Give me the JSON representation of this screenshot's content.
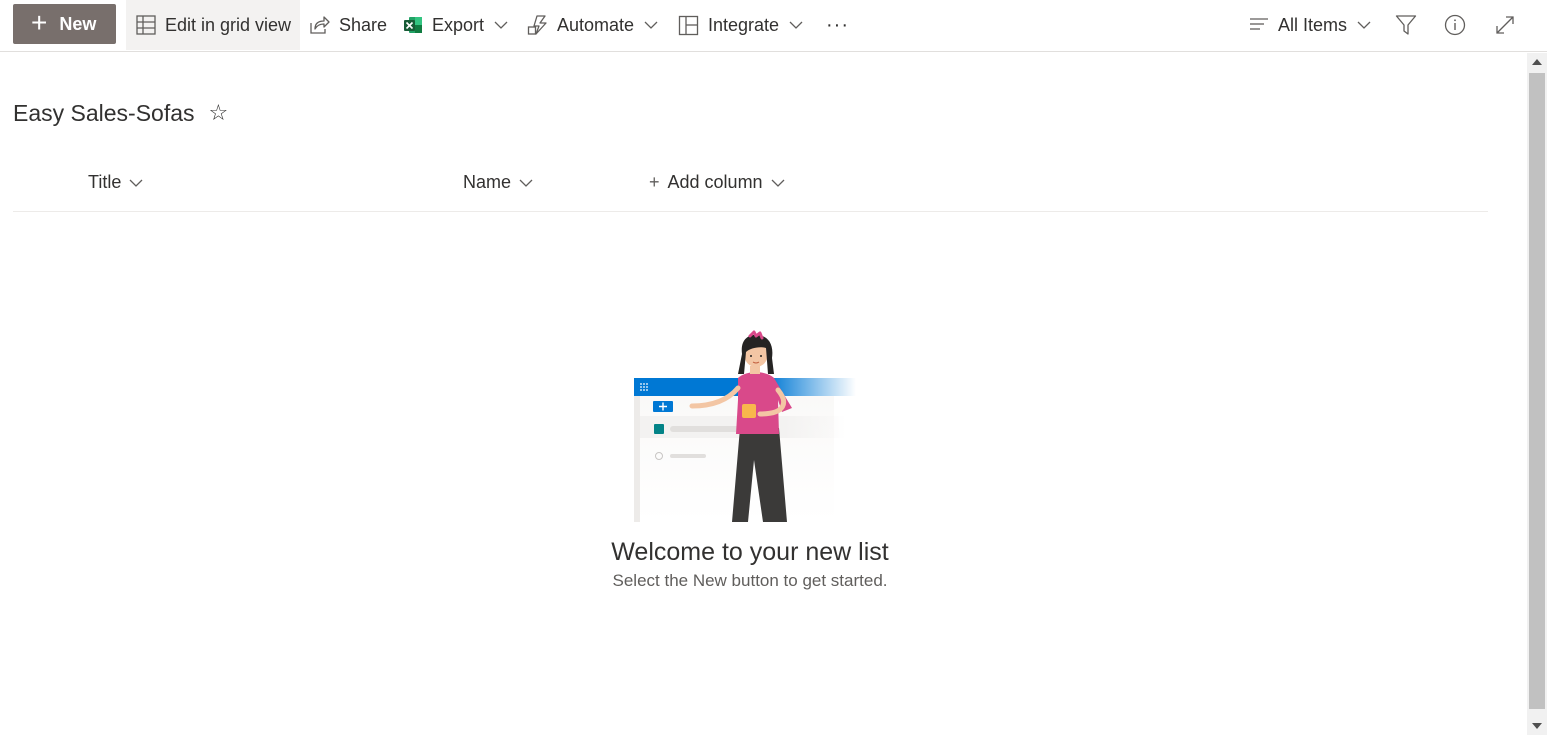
{
  "toolbar": {
    "new_label": "New",
    "grid_label": "Edit in grid view",
    "share_label": "Share",
    "export_label": "Export",
    "automate_label": "Automate",
    "integrate_label": "Integrate",
    "more_label": "···",
    "view_label": "All Items"
  },
  "list": {
    "title": "Easy Sales-Sofas",
    "star": "☆"
  },
  "columns": {
    "title": "Title",
    "name": "Name",
    "add_column": "Add column",
    "add_plus": "+"
  },
  "empty_state": {
    "heading": "Welcome to your new list",
    "subtext": "Select the New button to get started."
  },
  "colors": {
    "new_button_bg": "#786f6c",
    "accent_blue": "#0078d4",
    "illustration_pink": "#d9498a"
  }
}
